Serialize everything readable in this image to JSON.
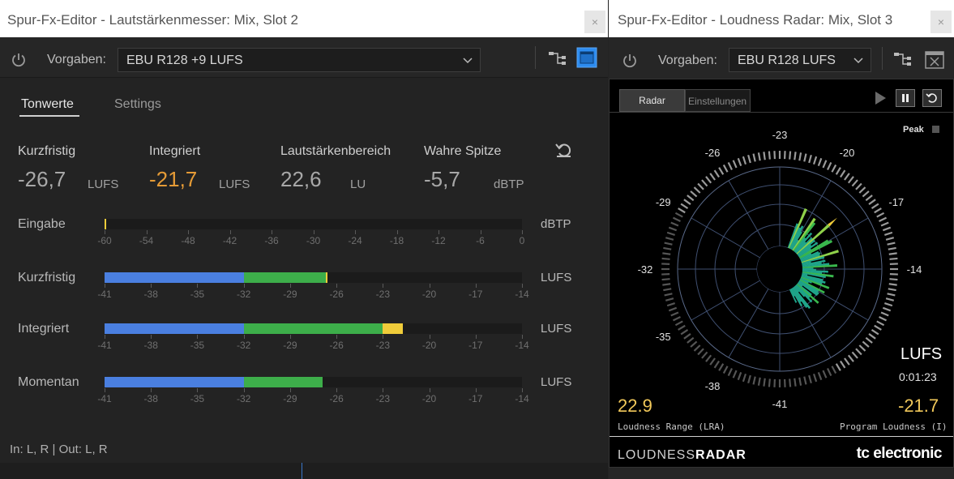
{
  "left_window": {
    "title": "Spur-Fx-Editor - Lautstärkenmesser: Mix, Slot 2",
    "close": "×",
    "presets_label": "Vorgaben:",
    "preset_value": "EBU R128 +9 LUFS",
    "tabs": [
      {
        "label": "Tonwerte",
        "active": true
      },
      {
        "label": "Settings",
        "active": false
      }
    ],
    "stats": [
      {
        "label": "Kurzfristig",
        "value": "-26,7",
        "unit": "LUFS",
        "highlight": false
      },
      {
        "label": "Integriert",
        "value": "-21,7",
        "unit": "LUFS",
        "highlight": true
      },
      {
        "label": "Lautstärkenbereich",
        "value": "22,6",
        "unit": "LU",
        "highlight": false
      },
      {
        "label": "Wahre Spitze",
        "value": "-5,7",
        "unit": "dBTP",
        "highlight": false
      }
    ],
    "meters": [
      {
        "label": "Eingabe",
        "unit": "dBTP",
        "scale": [
          "-60",
          "-54",
          "-48",
          "-42",
          "-36",
          "-30",
          "-24",
          "-18",
          "-12",
          "-6",
          "0"
        ],
        "min": -60,
        "max": 0,
        "level": -59.5
      },
      {
        "label": "Kurzfristig",
        "unit": "LUFS",
        "scale": [
          "-41",
          "-38",
          "-35",
          "-32",
          "-29",
          "-26",
          "-23",
          "-20",
          "-17",
          "-14"
        ],
        "min": -41,
        "max": -14,
        "level": -26.7,
        "peak_marker": -26.7
      },
      {
        "label": "Integriert",
        "unit": "LUFS",
        "scale": [
          "-41",
          "-38",
          "-35",
          "-32",
          "-29",
          "-26",
          "-23",
          "-20",
          "-17",
          "-14"
        ],
        "min": -41,
        "max": -14,
        "level": -21.7
      },
      {
        "label": "Momentan",
        "unit": "LUFS",
        "scale": [
          "-41",
          "-38",
          "-35",
          "-32",
          "-29",
          "-26",
          "-23",
          "-20",
          "-17",
          "-14"
        ],
        "min": -41,
        "max": -14,
        "level": -26.9
      }
    ],
    "footer": "In: L, R | Out: L, R"
  },
  "right_window": {
    "title": "Spur-Fx-Editor - Loudness Radar: Mix, Slot 3",
    "close": "×",
    "presets_label": "Vorgaben:",
    "preset_value": "EBU R128 LUFS",
    "tabs": [
      {
        "label": "Radar",
        "active": true
      },
      {
        "label": "Einstellungen",
        "active": false
      }
    ],
    "peak_label": "Peak",
    "radar_labels": [
      "-23",
      "-20",
      "-17",
      "-14",
      "-41",
      "-38",
      "-35",
      "-32",
      "-29",
      "-26"
    ],
    "unit": "LUFS",
    "time": "0:01:23",
    "loudness_range_value": "22.9",
    "loudness_range_label": "Loudness Range (LRA)",
    "program_loudness_value": "-21.7",
    "program_loudness_label": "Program Loudness (I)",
    "brand_left_a": "LOUDNESS",
    "brand_left_b": "RADAR",
    "brand_right": "tc electronic"
  },
  "colors": {
    "meter_blue": "#4a7fe0",
    "meter_green": "#3dae4a",
    "meter_yellow": "#f0cc3a",
    "accent_orange": "#e59b36",
    "preset_active_blue": "#2d8cf0"
  }
}
